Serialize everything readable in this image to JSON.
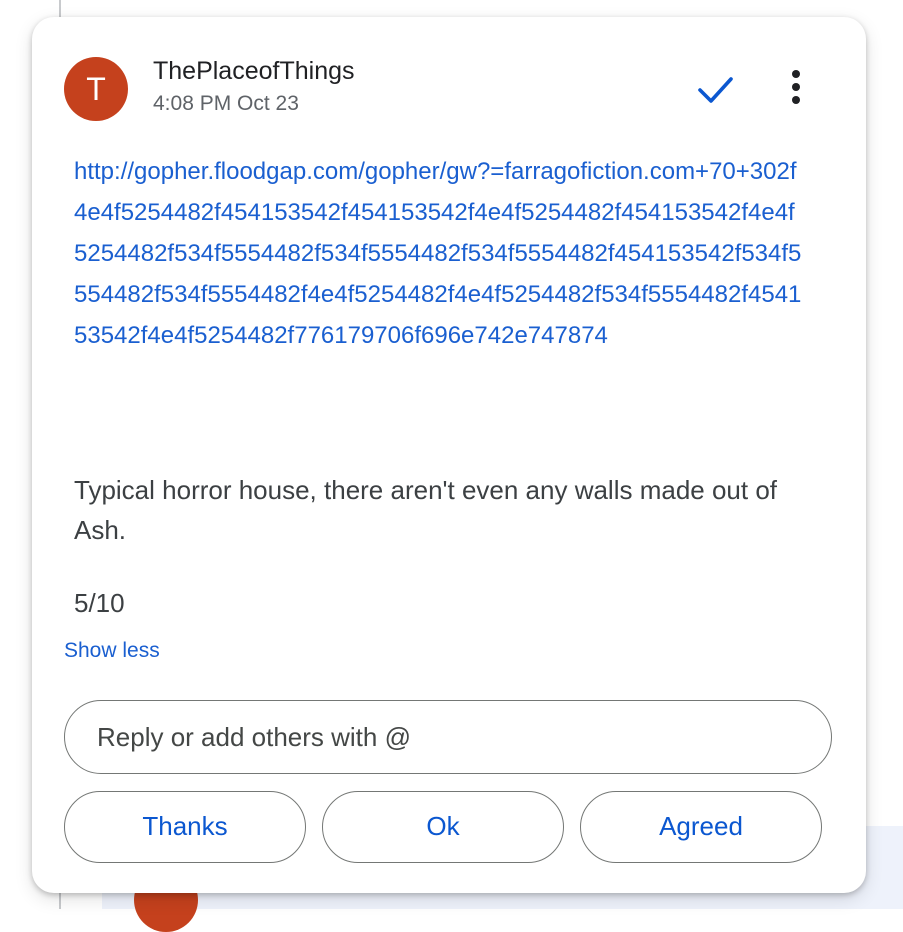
{
  "comment": {
    "avatar_letter": "T",
    "author": "ThePlaceofThings",
    "timestamp": "4:08 PM Oct 23",
    "link_text": "http://gopher.floodgap.com/gopher/gw?=farragofiction.com+70+302f4e4f5254482f454153542f454153542f4e4f5254482f454153542f4e4f5254482f534f5554482f534f5554482f534f5554482f454153542f534f5554482f534f5554482f4e4f5254482f4e4f5254482f534f5554482f454153542f4e4f5254482f776179706f696e742e747874",
    "body_text": "Typical horror house, there aren't even any walls made out of Ash.",
    "rating": "5/10",
    "show_less": "Show less"
  },
  "reply": {
    "placeholder": "Reply or add others with @"
  },
  "suggestions": [
    "Thanks",
    "Ok",
    "Agreed"
  ],
  "colors": {
    "avatar": "#c5411d",
    "link": "#1a5fd0",
    "accent": "#0b57d0"
  },
  "icons": {
    "resolve": "checkmark-icon",
    "more": "more-vertical-icon"
  }
}
